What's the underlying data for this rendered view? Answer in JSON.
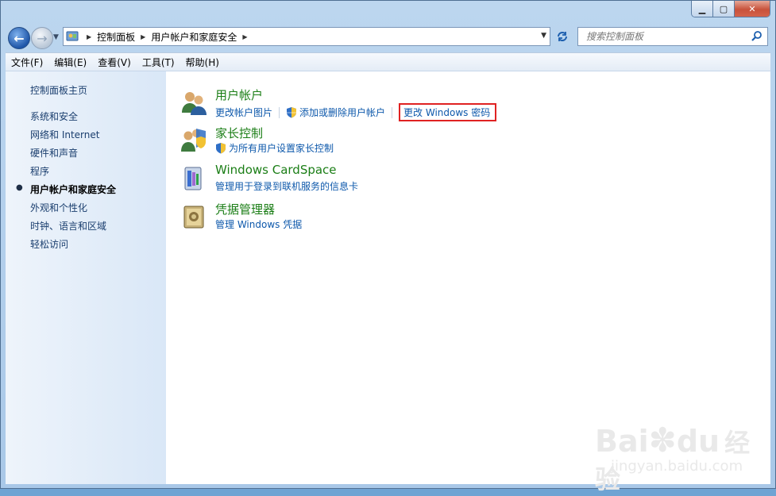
{
  "window": {
    "caption": {
      "minimize_label": "▁",
      "maximize_label": "▢",
      "close_label": "✕"
    }
  },
  "nav": {
    "back_label": "←",
    "forward_label": "→",
    "breadcrumb": [
      "控制面板",
      "用户帐户和家庭安全"
    ],
    "search_placeholder": "搜索控制面板"
  },
  "menu": {
    "items": [
      "文件(F)",
      "编辑(E)",
      "查看(V)",
      "工具(T)",
      "帮助(H)"
    ]
  },
  "sidebar": {
    "home": "控制面板主页",
    "items": [
      {
        "label": "系统和安全",
        "active": false
      },
      {
        "label": "网络和 Internet",
        "active": false
      },
      {
        "label": "硬件和声音",
        "active": false
      },
      {
        "label": "程序",
        "active": false
      },
      {
        "label": "用户帐户和家庭安全",
        "active": true
      },
      {
        "label": "外观和个性化",
        "active": false
      },
      {
        "label": "时钟、语言和区域",
        "active": false
      },
      {
        "label": "轻松访问",
        "active": false
      }
    ]
  },
  "categories": [
    {
      "title": "用户帐户",
      "icon": "user-accounts-icon",
      "tasks": [
        "更改帐户图片",
        "添加或删除用户帐户",
        "更改 Windows 密码"
      ]
    },
    {
      "title": "家长控制",
      "icon": "parental-controls-icon",
      "tasks": [
        "为所有用户设置家长控制"
      ]
    },
    {
      "title": "Windows CardSpace",
      "icon": "cardspace-icon",
      "tasks": [
        "管理用于登录到联机服务的信息卡"
      ]
    },
    {
      "title": "凭据管理器",
      "icon": "credential-manager-icon",
      "tasks": [
        "管理 Windows 凭据"
      ]
    }
  ],
  "watermark": {
    "brand": "Bai",
    "brand2": "du",
    "brand_cn": "经验",
    "url": "jingyan.baidu.com"
  },
  "colors": {
    "link": "#0d58ab",
    "category": "#1b7e16",
    "highlight_box": "#e02222"
  }
}
